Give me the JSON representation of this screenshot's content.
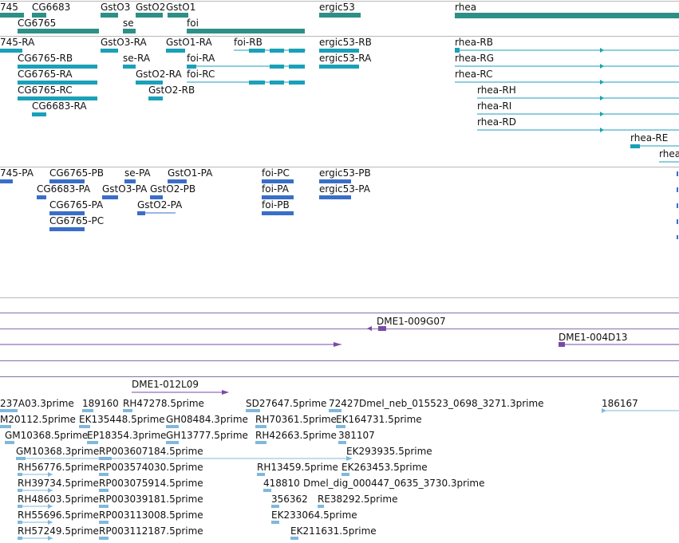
{
  "colors": {
    "gene": "#2c9086",
    "transcript": "#1aa0b8",
    "protein": "#3a6ec8",
    "clone": "#7a4aa8",
    "est": "#80b8dc",
    "separator": "#b8b8b8"
  },
  "gene_labels": [
    "745",
    "CG6683",
    "GstO3",
    "GstO2",
    "GstO1",
    "ergic53",
    "rhea",
    "CG6765",
    "se",
    "foi"
  ],
  "transcript_labels": [
    "745-RA",
    "GstO3-RA",
    "GstO1-RA",
    "foi-RB",
    "ergic53-RB",
    "rhea-RB",
    "CG6765-RB",
    "se-RA",
    "foi-RA",
    "ergic53-RA",
    "rhea-RG",
    "CG6765-RA",
    "GstO2-RA",
    "foi-RC",
    "rhea-RC",
    "CG6765-RC",
    "GstO2-RB",
    "rhea-RH",
    "CG6683-RA",
    "rhea-RI",
    "rhea-RD",
    "rhea-RE",
    "rhea"
  ],
  "protein_labels": [
    "745-PA",
    "CG6765-PB",
    "se-PA",
    "GstO1-PA",
    "foi-PC",
    "ergic53-PB",
    "CG6683-PA",
    "GstO3-PA",
    "GstO2-PB",
    "foi-PA",
    "ergic53-PA",
    "CG6765-PA",
    "GstO2-PA",
    "foi-PB",
    "CG6765-PC"
  ],
  "clone_labels": [
    "DME1-009G07",
    "DME1-004D13",
    "DME1-012L09"
  ],
  "est_labels": [
    "237A03.3prime",
    "189160",
    "RH47278.5prime",
    "SD27647.5prime",
    "72427",
    "Dmel_neb_015523_0698_3271.3prime",
    "186167",
    "M20112.5prime",
    "EK135448.5prime",
    "GH08484.3prime",
    "RH70361.5prime",
    "EK164731.5prime",
    "GM10368.5prime",
    "EP18354.3prime",
    "GH13777.5prime",
    "RH42663.5prime",
    "381107",
    "GM10368.3prime",
    "RP003607184.5prime",
    "EK293935.5prime",
    "RH56776.5prime",
    "RP003574030.5prime",
    "RH13459.5prime",
    "EK263453.5prime",
    "RH39734.5prime",
    "RP003075914.5prime",
    "418810",
    "Dmel_dig_000447_0635_3730.3prime",
    "RH48603.5prime",
    "RP003039181.5prime",
    "356362",
    "RE38292.5prime",
    "RH55696.5prime",
    "RP003113008.5prime",
    "EK233064.5prime",
    "RH57249.5prime",
    "RP003112187.5prime",
    "EK211631.5prime"
  ]
}
